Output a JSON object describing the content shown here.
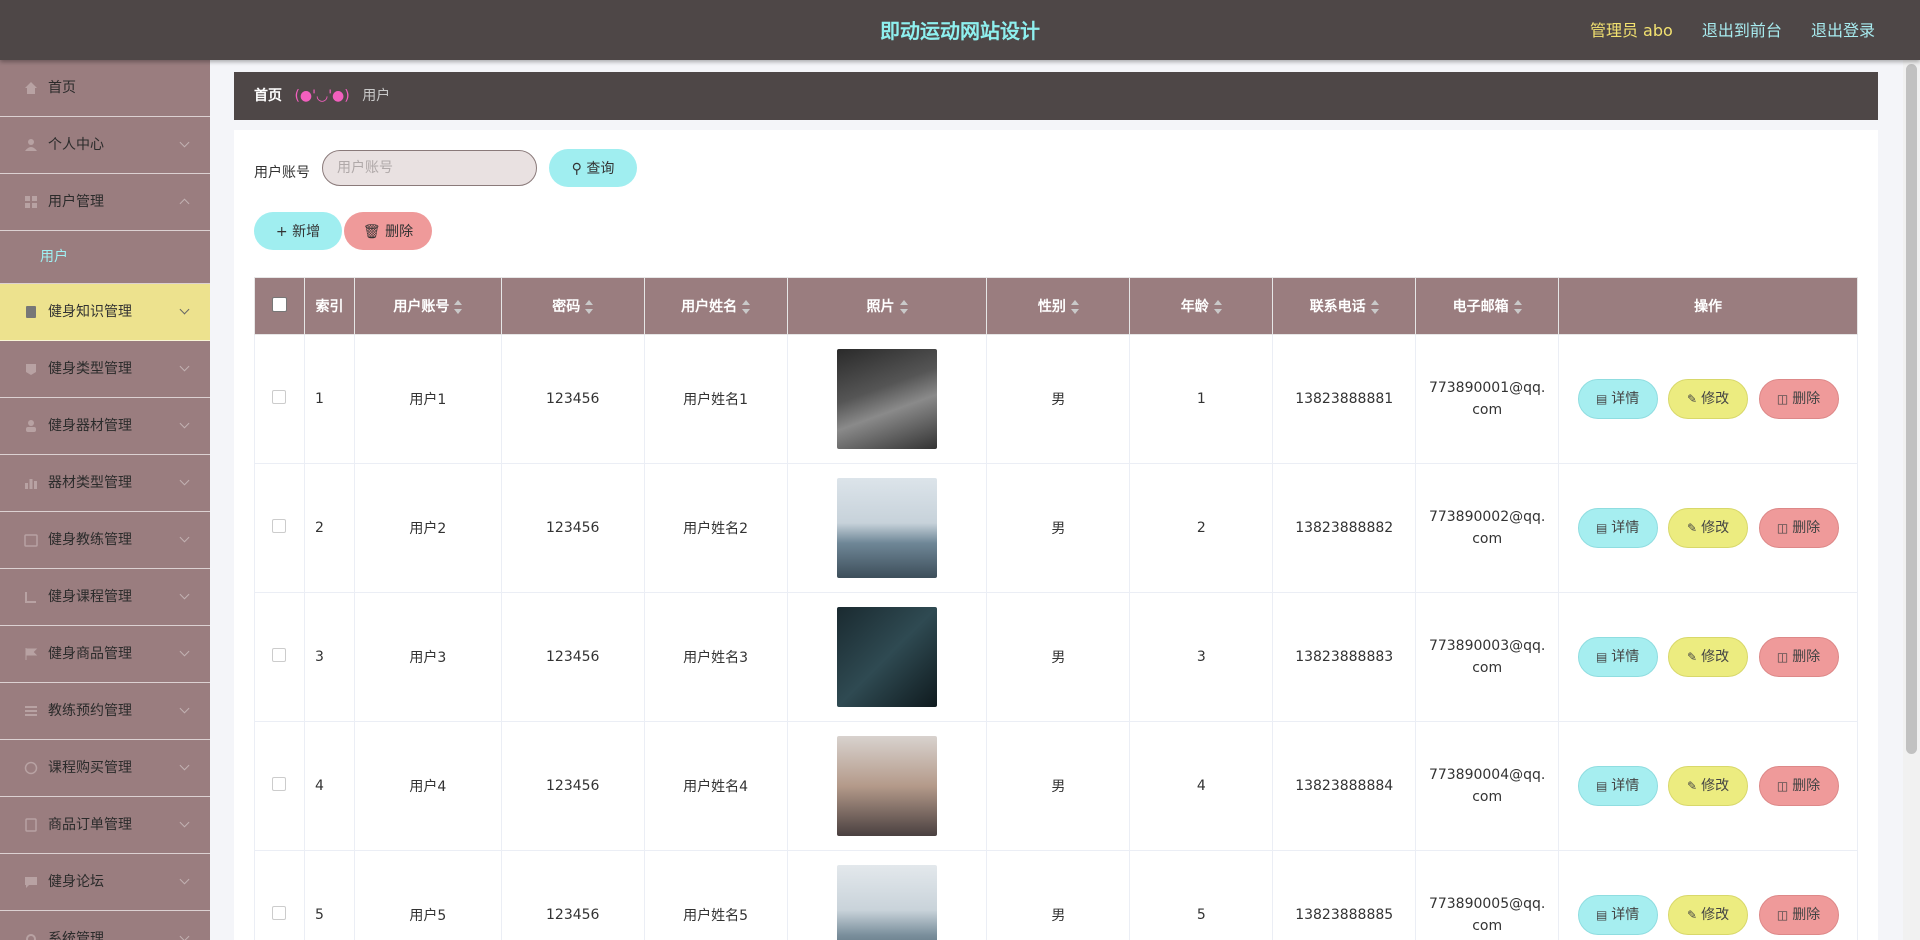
{
  "header": {
    "title": "即动运动网站设计",
    "admin": "管理员 abo",
    "to_front": "退出到前台",
    "logout": "退出登录"
  },
  "sidebar": {
    "items": [
      {
        "label": "首页",
        "icon": "home-icon"
      },
      {
        "label": "个人中心",
        "icon": "user-icon"
      },
      {
        "label": "用户管理",
        "icon": "grid-icon"
      },
      {
        "label": "健身知识管理",
        "icon": "book-icon",
        "active": true
      },
      {
        "label": "健身类型管理",
        "icon": "tag-icon"
      },
      {
        "label": "健身器材管理",
        "icon": "person-icon"
      },
      {
        "label": "器材类型管理",
        "icon": "chart-icon"
      },
      {
        "label": "健身教练管理",
        "icon": "calendar-icon"
      },
      {
        "label": "健身课程管理",
        "icon": "course-icon"
      },
      {
        "label": "健身商品管理",
        "icon": "flag-icon"
      },
      {
        "label": "教练预约管理",
        "icon": "list-icon"
      },
      {
        "label": "课程购买管理",
        "icon": "clock-icon"
      },
      {
        "label": "商品订单管理",
        "icon": "order-icon"
      },
      {
        "label": "健身论坛",
        "icon": "forum-icon"
      },
      {
        "label": "系统管理",
        "icon": "settings-icon"
      }
    ],
    "submenu": [
      "用户"
    ]
  },
  "breadcrumb": {
    "home": "首页",
    "sep": "(●'◡'●)",
    "current": "用户"
  },
  "search": {
    "label": "用户账号",
    "placeholder": "用户账号",
    "query_label": "查询"
  },
  "toolbar": {
    "add_label": "新增",
    "delete_label": "删除"
  },
  "table": {
    "columns": [
      "索引",
      "用户账号",
      "密码",
      "用户姓名",
      "照片",
      "性别",
      "年龄",
      "联系电话",
      "电子邮箱",
      "操作"
    ],
    "actions": {
      "detail": "详情",
      "edit": "修改",
      "delete": "删除"
    },
    "rows": [
      {
        "index": "1",
        "account": "用户1",
        "password": "123456",
        "name": "用户姓名1",
        "gender": "男",
        "age": "1",
        "phone": "13823888881",
        "email": "773890001@qq.com"
      },
      {
        "index": "2",
        "account": "用户2",
        "password": "123456",
        "name": "用户姓名2",
        "gender": "男",
        "age": "2",
        "phone": "13823888882",
        "email": "773890002@qq.com"
      },
      {
        "index": "3",
        "account": "用户3",
        "password": "123456",
        "name": "用户姓名3",
        "gender": "男",
        "age": "3",
        "phone": "13823888883",
        "email": "773890003@qq.com"
      },
      {
        "index": "4",
        "account": "用户4",
        "password": "123456",
        "name": "用户姓名4",
        "gender": "男",
        "age": "4",
        "phone": "13823888884",
        "email": "773890004@qq.com"
      },
      {
        "index": "5",
        "account": "用户5",
        "password": "123456",
        "name": "用户姓名5",
        "gender": "男",
        "age": "5",
        "phone": "13823888885",
        "email": "773890005@qq.com"
      }
    ]
  },
  "colors": {
    "header_bg": "#4e4747",
    "sidebar_bg": "#9a7d7f",
    "title": "#8ef0ef",
    "active_menu": "#ede28e",
    "cyan_btn": "#a0eef0",
    "red_btn": "#ef9a9a",
    "yellow_btn": "#ecec80"
  }
}
